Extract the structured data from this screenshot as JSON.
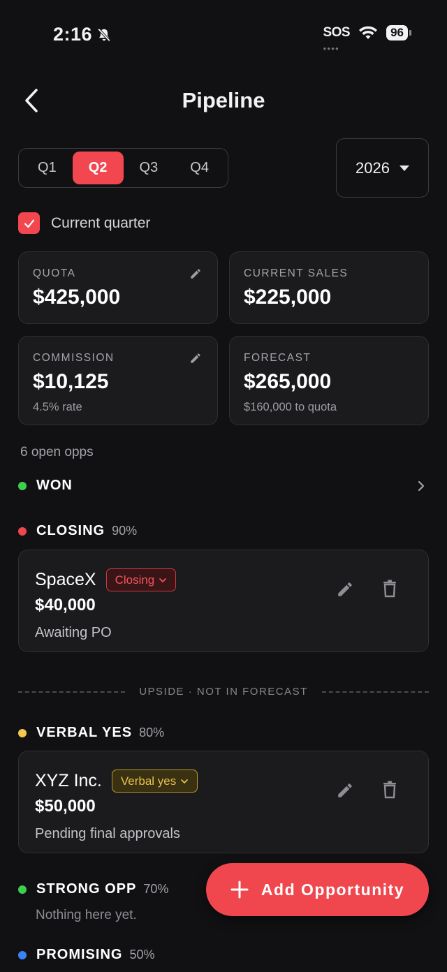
{
  "status_bar": {
    "time": "2:16",
    "carrier": "SOS",
    "battery": "96"
  },
  "header": {
    "title": "Pipeline"
  },
  "quarters": [
    "Q1",
    "Q2",
    "Q3",
    "Q4"
  ],
  "selected_quarter": "Q2",
  "year": "2026",
  "current_quarter": {
    "label": "Current quarter",
    "checked": true
  },
  "stats": {
    "quota": {
      "label": "QUOTA",
      "value": "$425,000"
    },
    "current_sales": {
      "label": "CURRENT SALES",
      "value": "$225,000"
    },
    "commission": {
      "label": "COMMISSION",
      "value": "$10,125",
      "sub": "4.5% rate"
    },
    "forecast": {
      "label": "FORECAST",
      "value": "$265,000",
      "sub": "$160,000 to quota"
    }
  },
  "open_opps": "6 open opps",
  "stages": {
    "won": {
      "name": "WON",
      "color": "#3ccf4e"
    },
    "closing": {
      "name": "CLOSING",
      "pct": "90%",
      "color": "#f0474f"
    },
    "verbal_yes": {
      "name": "VERBAL YES",
      "pct": "80%",
      "color": "#f2c94c"
    },
    "strong_opp": {
      "name": "STRONG OPP",
      "pct": "70%",
      "color": "#3ccf4e",
      "empty": "Nothing here yet."
    },
    "promising": {
      "name": "PROMISING",
      "pct": "50%",
      "color": "#3b82f6"
    }
  },
  "opportunities": {
    "spacex": {
      "name": "SpaceX",
      "badge": "Closing",
      "amount": "$40,000",
      "note": "Awaiting PO"
    },
    "xyz": {
      "name": "XYZ Inc.",
      "badge": "Verbal yes",
      "amount": "$50,000",
      "note": "Pending final approvals"
    }
  },
  "upside_divider": "UPSIDE · NOT IN FORECAST",
  "fab": {
    "label": "Add Opportunity"
  },
  "accent_color": "#f0474f"
}
